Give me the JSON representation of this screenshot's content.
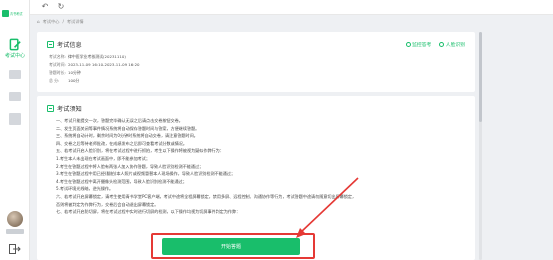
{
  "app": {
    "brand": "青书考试"
  },
  "sidebar": {
    "items": [
      {
        "label": "考试中心",
        "icon": "document-edit-icon"
      }
    ]
  },
  "topbar": {
    "back": "back-icon",
    "refresh": "refresh-icon"
  },
  "breadcrumb": {
    "items": [
      "考试中心",
      "考试详情"
    ]
  },
  "exam_info": {
    "title": "考试信息",
    "tags": [
      "监控答考",
      "人脸识别"
    ],
    "rows": [
      {
        "label": "考试名称:",
        "value": "律中医学业考核测试(20231110)"
      },
      {
        "label": "考试时间:",
        "value": "2023-11-09 16:10-2023-11-09 16:20"
      },
      {
        "label": "答题时长:",
        "value": "10分钟"
      },
      {
        "label": "总    分:",
        "value": "100分"
      }
    ]
  },
  "notice": {
    "title": "考试须知",
    "items": [
      "一、考试只能提交一次，答题完毕确认无误之后请点击交卷按钮交卷。",
      "二、发生页面关闭等事件情况系统将自动保存答题时间与答案，方便继续答题。",
      "三、系统将自动计时，剩余时间为0分钟时系统将自动交卷，请注意答题时间。",
      "四、交卷之后等待老师批改，在成绩发布之后即可查看考试分数或情况。",
      "五、若考试开启人脸识别，将在考试过程中进行抓拍，考生以下操作将被视为疑似作弊行为：",
      "1.考生本人未出现在考试画面中，即不能参加考试；",
      "2.考生在答题过程中将人脸有两张人加入协作答题，导致人脸识别检测不能通过；",
      "3.考生在答题过程中用已经(翻拍)本人照片或视频冒替本人现场操作，导致人脸识别检测不能通过；",
      "4.考生在答题过程中离开摄像头检测范围，导致人脸识别检测不能通过；",
      "5.考试环境光线暗，逆光操作。",
      "六、若考试开启屏幕锁定，请考生使用青书学堂PC客户端，考试中途将全程屏幕锁定，禁用多屏、远程控制、沟通协作等行为，考试答题中途请勿随意切出屏幕锁定，",
      "    否则将被判定为作弊行为，交卷后会自动退出屏幕锁定。",
      "七、若考试开启防切屏，将在考试过程中实时进行切屏的检测，以下操作均视为切屏事件判定为作弊："
    ]
  },
  "actions": {
    "start_label": "开始答题"
  },
  "colors": {
    "accent": "#19be6b",
    "highlight": "#e53935"
  }
}
